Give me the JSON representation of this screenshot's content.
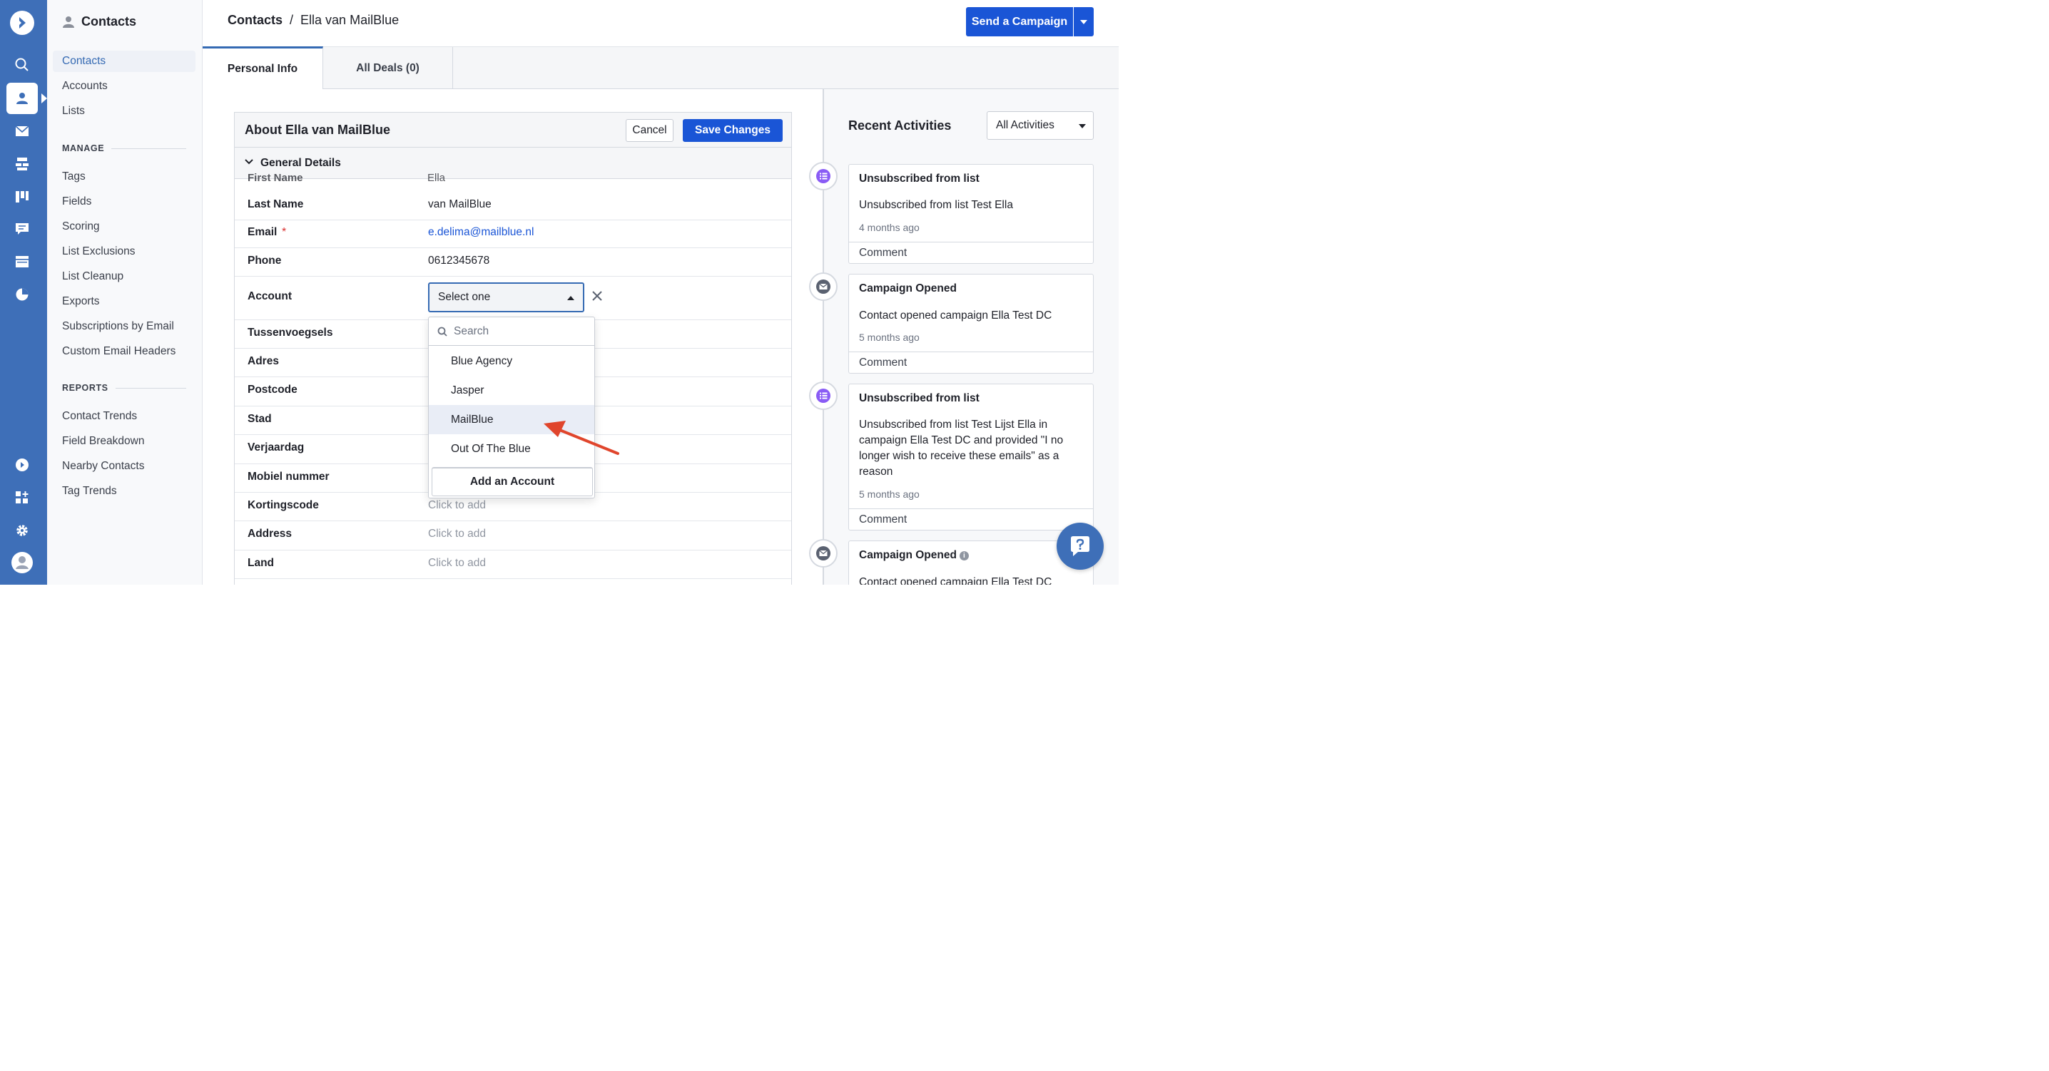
{
  "rail": {
    "icons": [
      "logo-icon",
      "search-icon",
      "contacts-icon",
      "email-icon",
      "automations-icon",
      "deals-icon",
      "conversations-icon",
      "site-icon",
      "reports-icon",
      "activecampaign-icon",
      "apps-icon",
      "settings-icon",
      "avatar-icon"
    ]
  },
  "sidebar": {
    "title": "Contacts",
    "items": [
      "Contacts",
      "Accounts",
      "Lists"
    ],
    "manage_heading": "MANAGE",
    "manage_items": [
      "Tags",
      "Fields",
      "Scoring",
      "List Exclusions",
      "List Cleanup",
      "Exports",
      "Subscriptions by Email",
      "Custom Email Headers"
    ],
    "reports_heading": "REPORTS",
    "report_items": [
      "Contact Trends",
      "Field Breakdown",
      "Nearby Contacts",
      "Tag Trends"
    ]
  },
  "header": {
    "breadcrumb_root": "Contacts",
    "breadcrumb_sep": "/",
    "breadcrumb_current": "Ella van MailBlue",
    "send_button": "Send a Campaign"
  },
  "tabs": [
    "Personal Info",
    "All Deals (0)"
  ],
  "card": {
    "title": "About Ella van MailBlue",
    "cancel": "Cancel",
    "save": "Save Changes",
    "group_title": "General Details",
    "cut_label": "First Name",
    "cut_value": "Ella"
  },
  "fields": [
    {
      "label": "Last Name",
      "value": "van MailBlue",
      "kind": "text"
    },
    {
      "label": "Email",
      "value": "e.delima@mailblue.nl",
      "kind": "link",
      "required": "*"
    },
    {
      "label": "Phone",
      "value": "0612345678",
      "kind": "text"
    },
    {
      "label": "Account",
      "value": "Select one",
      "kind": "select"
    },
    {
      "label": "Tussenvoegsels",
      "value": "",
      "kind": "text"
    },
    {
      "label": "Adres",
      "value": "",
      "kind": "text"
    },
    {
      "label": "Postcode",
      "value": "",
      "kind": "text"
    },
    {
      "label": "Stad",
      "value": "",
      "kind": "text"
    },
    {
      "label": "Verjaardag",
      "value": "",
      "kind": "text"
    },
    {
      "label": "Mobiel nummer",
      "value": "",
      "kind": "text"
    },
    {
      "label": "Kortingscode",
      "value": "Click to add",
      "kind": "muted"
    },
    {
      "label": "Address",
      "value": "Click to add",
      "kind": "muted"
    },
    {
      "label": "Land",
      "value": "Click to add",
      "kind": "muted"
    }
  ],
  "dropdown": {
    "search_placeholder": "Search",
    "options": [
      "Blue Agency",
      "Jasper",
      "MailBlue",
      "Out Of The Blue"
    ],
    "highlighted": "MailBlue",
    "add": "Add an Account"
  },
  "activities": {
    "title": "Recent Activities",
    "filter": "All Activities",
    "items": [
      {
        "type": "list",
        "title": "Unsubscribed from list",
        "body": "Unsubscribed from list Test Ella",
        "time": "4 months ago",
        "comment": "Comment"
      },
      {
        "type": "email",
        "title": "Campaign Opened",
        "body": "Contact opened campaign Ella Test DC",
        "time": "5 months ago",
        "comment": "Comment"
      },
      {
        "type": "list",
        "title": "Unsubscribed from list",
        "body": "Unsubscribed from list Test Lijst Ella in campaign Ella Test DC and provided \"I no longer wish to receive these emails\" as a reason",
        "time": "5 months ago",
        "comment": "Comment"
      },
      {
        "type": "email",
        "title": "Campaign Opened",
        "body": "Contact opened campaign Ella Test DC",
        "time": "",
        "comment": ""
      }
    ]
  },
  "colors": {
    "rail": "#3e6fb8",
    "primary": "#1a55d6",
    "annotation": "#e0452c",
    "list_icon": "#8a5cf5"
  }
}
